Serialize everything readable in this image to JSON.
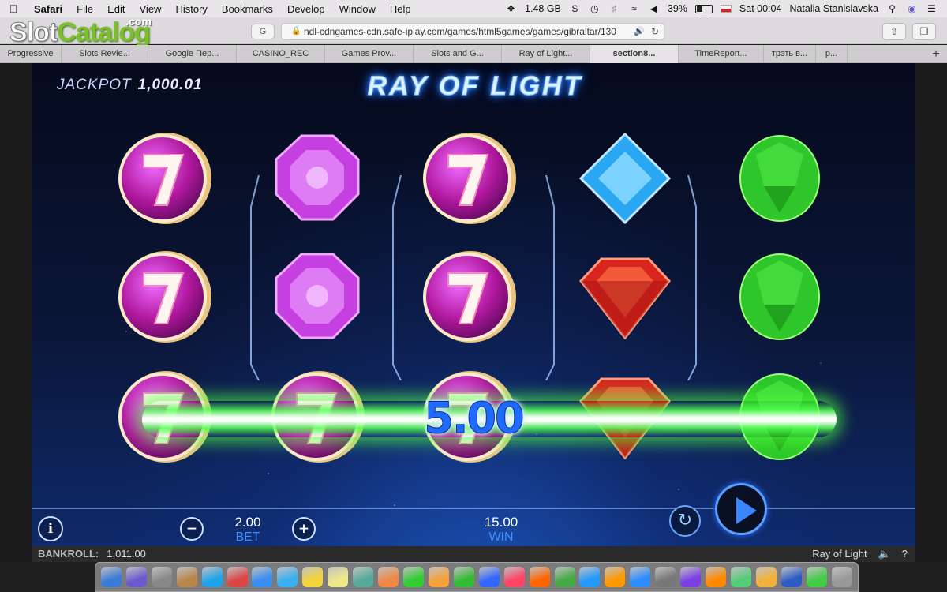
{
  "menubar": {
    "apple": "",
    "items": [
      "Safari",
      "File",
      "Edit",
      "View",
      "History",
      "Bookmarks",
      "Develop",
      "Window",
      "Help"
    ],
    "memory": "1.48 GB",
    "battery": "39%",
    "battery_level": 0.39,
    "clock": "Sat 00:04",
    "user": "Natalia Stanislavska"
  },
  "watermark": {
    "slot": "Slot",
    "catalog": "Catalog",
    "dotcom": ".com"
  },
  "toolbar": {
    "url": "ndl-cdngames-cdn.safe-iplay.com/games/html5games/games/gibraltar/130",
    "g_label": "G"
  },
  "tabs": [
    {
      "label": "Progressive"
    },
    {
      "label": "Slots Revie..."
    },
    {
      "label": "Google Пер..."
    },
    {
      "label": "CASINO_REC"
    },
    {
      "label": "Games Prov..."
    },
    {
      "label": "Slots and G..."
    },
    {
      "label": "Ray of Light..."
    },
    {
      "label": "section8...",
      "active": true
    },
    {
      "label": "TimeReport..."
    },
    {
      "label": "трэть в..."
    },
    {
      "label": "р..."
    }
  ],
  "game": {
    "title": "RAY OF LIGHT",
    "jackpot_label": "JACKPOT",
    "jackpot_value": "1,000.01",
    "win_popup": "5.00",
    "reels": [
      [
        "seven",
        "seven",
        "seven"
      ],
      [
        "octagon-gem",
        "octagon-gem",
        "seven"
      ],
      [
        "seven",
        "seven",
        "seven"
      ],
      [
        "blue-diamond",
        "red-gem",
        "red-gem"
      ],
      [
        "green-gem",
        "green-gem",
        "green-gem"
      ]
    ],
    "bet_value": "2.00",
    "bet_label": "BET",
    "win_value": "15.00",
    "win_label": "WIN"
  },
  "bankroll": {
    "label": "BANKROLL:",
    "value": "1,011.00",
    "game_name": "Ray of Light",
    "sound_icon": "speaker-icon",
    "help": "?"
  },
  "dock": {
    "icons": [
      "finder-icon",
      "siri-icon",
      "launchpad-icon",
      "contacts-icon",
      "skype-icon",
      "photos-icon",
      "safari-icon",
      "messages-icon",
      "notes-icon",
      "stickies-icon",
      "preview-icon",
      "photos-app-icon",
      "facetime-icon",
      "pages-icon",
      "numbers-icon",
      "keynote-icon",
      "music-icon",
      "firefox-icon",
      "chrome-icon",
      "appstore-icon",
      "books-icon",
      "zoom-icon",
      "prefs-icon",
      "viber-icon",
      "vlc-icon",
      "screenshot-icon",
      "sketch-icon",
      "word-icon",
      "utorrent-icon",
      "trash-icon"
    ]
  }
}
